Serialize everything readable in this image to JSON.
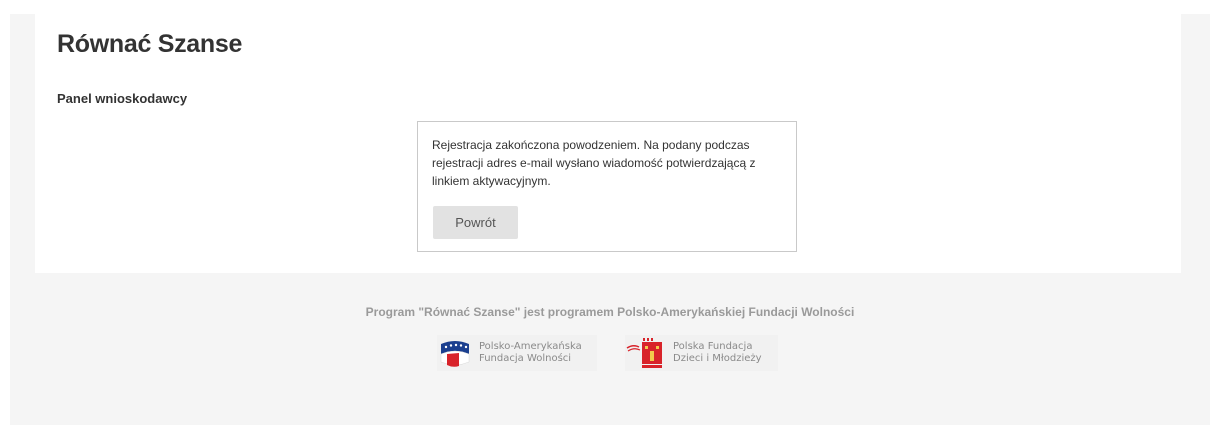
{
  "header": {
    "site_title": "Równać Szanse"
  },
  "panel": {
    "heading": "Panel wnioskodawcy",
    "message": "Rejestracja zakończona powodzeniem. Na podany podczas rejestracji adres e-mail wysłano wiadomość potwierdzającą z linkiem aktywacyjnym.",
    "back_button_label": "Powrót"
  },
  "footer": {
    "program_text": "Program \"Równać Szanse\" jest programem Polsko-Amerykańskiej Fundacji Wolności",
    "logos": [
      {
        "icon": "pafw-flag-icon",
        "line1": "Polsko-Amerykańska",
        "line2": "Fundacja Wolności"
      },
      {
        "icon": "pfdim-icon",
        "line1": "Polska Fundacja",
        "line2": "Dzieci i Młodzieży"
      }
    ]
  },
  "colors": {
    "page_background": "#f5f5f5",
    "panel_background": "#ffffff",
    "button_background": "#e2e2e2",
    "pafw_blue": "#1b3f8f",
    "pafw_red": "#d8232a",
    "pfdim_red": "#d8232a"
  }
}
